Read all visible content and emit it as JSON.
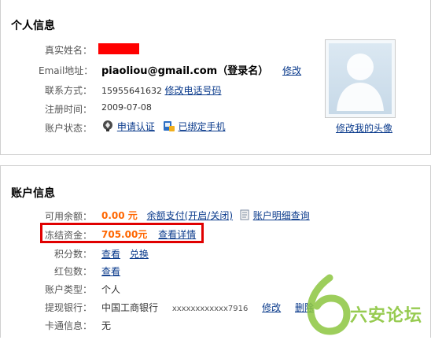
{
  "personal": {
    "title": "个人信息",
    "real_name_label": "真实姓名：",
    "email_label": "Email地址：",
    "email_value": "piaoliou@gmail.com",
    "email_note": "（登录名）",
    "email_edit": "修改",
    "phone_label": "联系方式：",
    "phone_value": "15955641632",
    "phone_edit": "修改电话号码",
    "reg_label": "注册时间：",
    "reg_value": "2009-07-08",
    "status_label": "账户状态：",
    "status_apply": "申请认证",
    "status_phone": "已绑定手机",
    "avatar_edit": "修改我的头像",
    "redacted_color": "#ff0000"
  },
  "account": {
    "title": "账户信息",
    "balance_label": "可用余额：",
    "balance_value": "0.00 元",
    "balance_pay": "余额支付(开启/关闭)",
    "balance_detail": "账户明细查询",
    "frozen_label": "冻结资金：",
    "frozen_value": "705.00元",
    "frozen_detail": "查看详情",
    "points_label": "积分数：",
    "points_view": "查看",
    "points_exchange": "兑换",
    "redpack_label": "红包数：",
    "redpack_view": "查看",
    "type_label": "账户类型：",
    "type_value": "个人",
    "bank_label": "提现银行：",
    "bank_name": "中国工商银行",
    "bank_account": "xxxxxxxxxxxx7916",
    "bank_edit": "修改",
    "bank_delete": "删除",
    "card_label": "卡通信息：",
    "card_value": "无",
    "highlight_color": "#e00000",
    "amount_color": "#ff6600"
  },
  "watermark": {
    "text": "六安论坛",
    "color": "#8cc63f"
  }
}
